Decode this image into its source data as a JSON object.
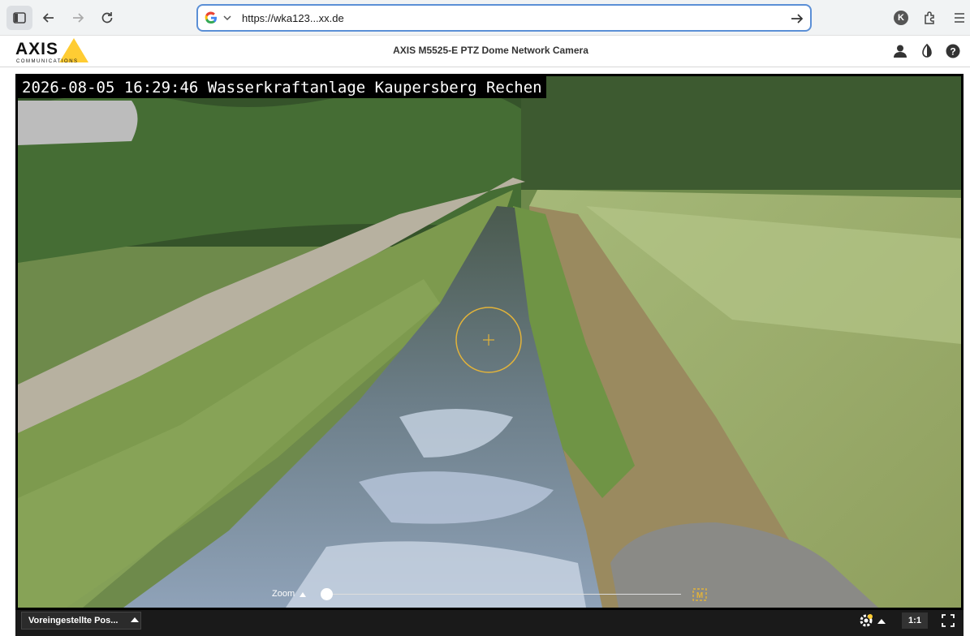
{
  "browser": {
    "url": "https://wka123...xx.de",
    "profile_initial": "K",
    "icons": [
      "sidebar-icon",
      "back-icon",
      "forward-icon",
      "reload-icon",
      "google-icon",
      "chevron-down-icon",
      "go-arrow-icon",
      "extensions-icon",
      "menu-icon"
    ]
  },
  "header": {
    "logo_text": "AXIS",
    "logo_subtext": "COMMUNICATIONS",
    "title": "AXIS M5525-E PTZ Dome Network Camera",
    "icons": [
      "user-icon",
      "contrast-icon",
      "help-icon"
    ]
  },
  "video": {
    "overlay_text": "2026-08-05 16:29:46 Wasserkraftanlage Kaupersberg Rechen",
    "zoom_label": "Zoom",
    "zoom_level": 0.0,
    "manual_icon_letter": "M"
  },
  "bottom": {
    "preset_label": "Voreingestellte Pos...",
    "ratio_label": "1:1"
  },
  "colors": {
    "accent": "#ffcc33",
    "url_focus": "#5b8fd6",
    "player_bg": "#1a1a1a"
  }
}
